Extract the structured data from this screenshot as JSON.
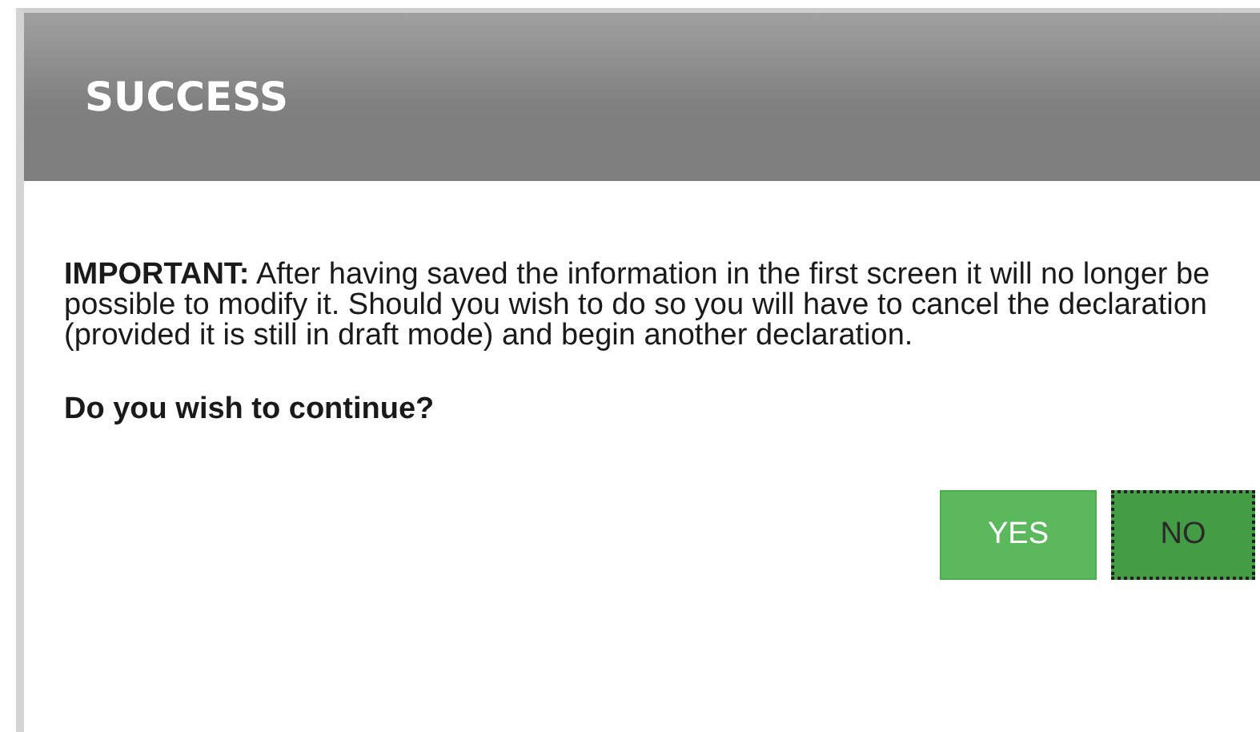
{
  "dialog": {
    "title": "SUCCESS",
    "message": "**IMPORTANT:** After having saved the information in the first screen it will no longer be possible to modify it. Should you wish to do so you will have to cancel the declaration (provided it is still in draft mode) and begin another declaration.",
    "question": "Do you wish to continue?",
    "buttons": [
      {
        "label": "YES",
        "focused": false
      },
      {
        "label": "NO",
        "focused": true
      }
    ]
  }
}
